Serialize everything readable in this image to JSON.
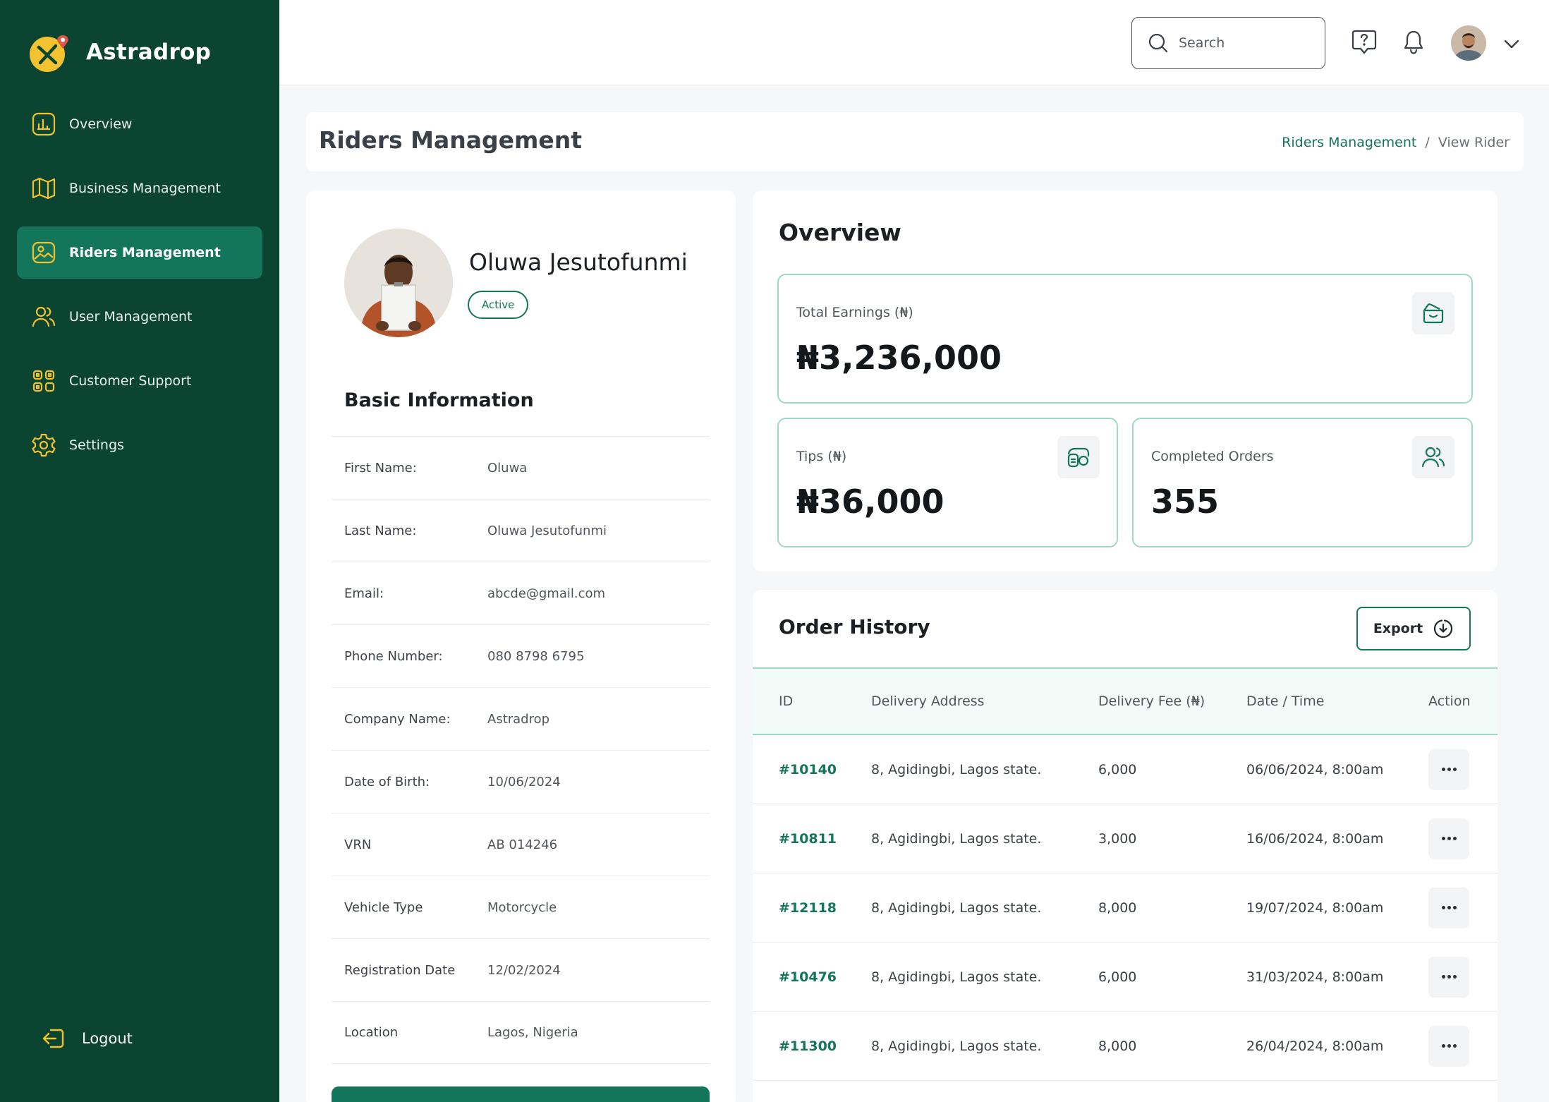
{
  "app": {
    "brand_name": "Astradrop"
  },
  "sidebar": {
    "items": [
      {
        "label": "Overview",
        "icon": "chart-icon"
      },
      {
        "label": "Business Management",
        "icon": "map-icon"
      },
      {
        "label": "Riders Management",
        "icon": "rider-icon",
        "active": true
      },
      {
        "label": "User Management",
        "icon": "users-icon"
      },
      {
        "label": "Customer Support",
        "icon": "support-icon"
      },
      {
        "label": "Settings",
        "icon": "gear-icon"
      }
    ],
    "logout_label": "Logout"
  },
  "topbar": {
    "search_placeholder": "Search"
  },
  "page": {
    "title": "Riders Management",
    "breadcrumb": {
      "parent": "Riders Management",
      "separator": "/",
      "current": "View Rider"
    }
  },
  "rider": {
    "name": "Oluwa Jesutofunmi",
    "status": "Active",
    "section_title": "Basic Information",
    "info": [
      {
        "label": "First Name:",
        "value": "Oluwa"
      },
      {
        "label": "Last Name:",
        "value": "Oluwa Jesutofunmi"
      },
      {
        "label": "Email:",
        "value": "abcde@gmail.com"
      },
      {
        "label": "Phone Number:",
        "value": "080 8798 6795"
      },
      {
        "label": "Company Name:",
        "value": "Astradrop"
      },
      {
        "label": "Date of Birth:",
        "value": "10/06/2024"
      },
      {
        "label": "VRN",
        "value": "AB 014246"
      },
      {
        "label": "Vehicle Type",
        "value": "Motorcycle"
      },
      {
        "label": "Registration Date",
        "value": "12/02/2024"
      },
      {
        "label": "Location",
        "value": "Lagos, Nigeria"
      }
    ]
  },
  "overview": {
    "title": "Overview",
    "total_earnings": {
      "label": "Total Earnings (₦)",
      "value": "₦3,236,000"
    },
    "tips": {
      "label": "Tips (₦)",
      "value": "₦36,000"
    },
    "completed_orders": {
      "label": "Completed Orders",
      "value": "355"
    }
  },
  "orders": {
    "title": "Order History",
    "export_label": "Export",
    "columns": [
      "ID",
      "Delivery Address",
      "Delivery Fee (₦)",
      "Date / Time",
      "Action"
    ],
    "rows": [
      {
        "id": "#10140",
        "address": "8, Agidingbi, Lagos state.",
        "fee": "6,000",
        "datetime": "06/06/2024, 8:00am"
      },
      {
        "id": "#10811",
        "address": "8, Agidingbi, Lagos state.",
        "fee": "3,000",
        "datetime": "16/06/2024, 8:00am"
      },
      {
        "id": "#12118",
        "address": "8, Agidingbi, Lagos state.",
        "fee": "8,000",
        "datetime": "19/07/2024, 8:00am"
      },
      {
        "id": "#10476",
        "address": "8, Agidingbi, Lagos state.",
        "fee": "6,000",
        "datetime": "31/03/2024, 8:00am"
      },
      {
        "id": "#11300",
        "address": "8, Agidingbi, Lagos state.",
        "fee": "8,000",
        "datetime": "26/04/2024, 8:00am"
      }
    ]
  },
  "colors": {
    "sidebar_bg": "#0b4431",
    "accent": "#13765a",
    "icon_yellow": "#f2c230",
    "card_border": "#9fd8c6"
  }
}
